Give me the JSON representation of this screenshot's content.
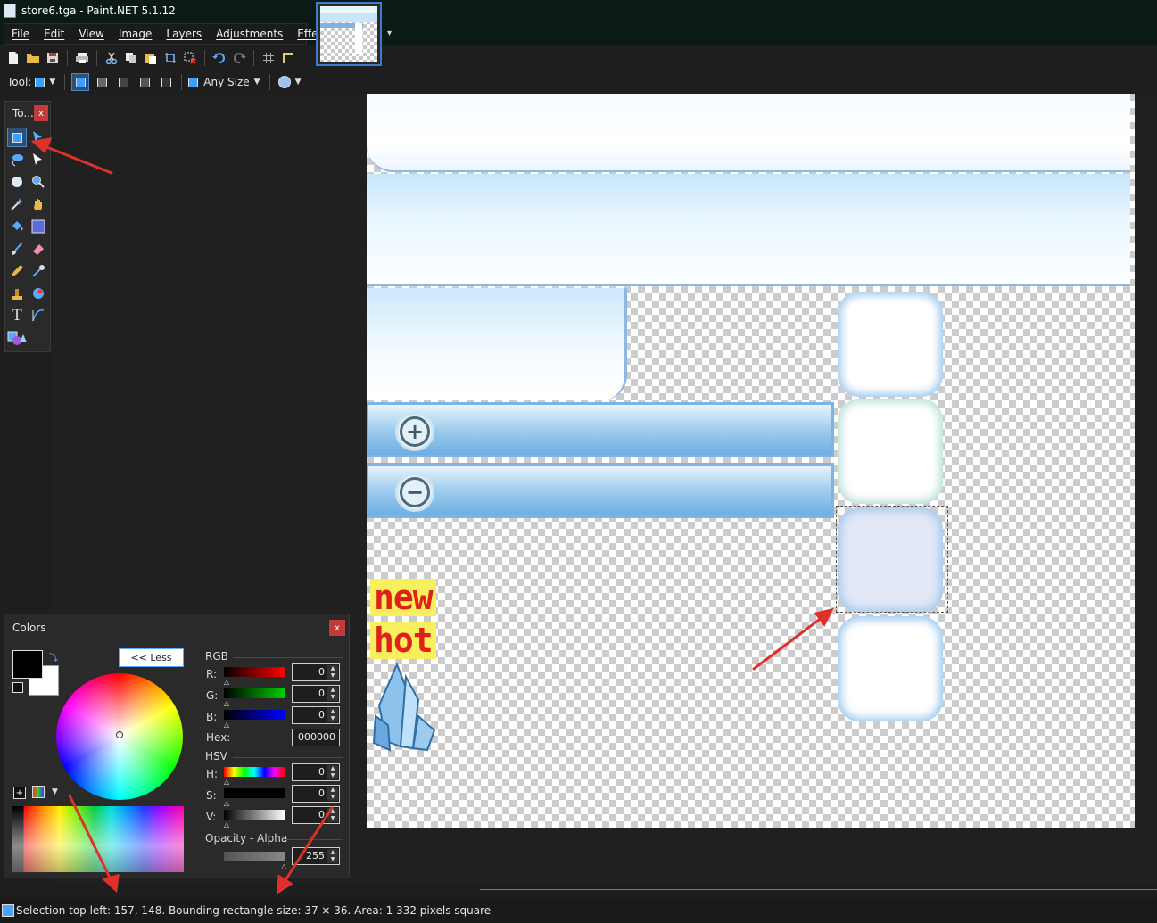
{
  "window": {
    "title": "store6.tga - Paint.NET 5.1.12"
  },
  "menu": {
    "items": [
      "File",
      "Edit",
      "View",
      "Image",
      "Layers",
      "Adjustments",
      "Effects"
    ]
  },
  "toolbar": {
    "icons": [
      "new-icon",
      "open-icon",
      "save-icon",
      "print-icon",
      "cut-icon",
      "copy-icon",
      "paste-icon",
      "crop-icon",
      "deselect-icon",
      "undo-icon",
      "redo-icon",
      "grid-icon",
      "ruler-icon"
    ],
    "tool_label": "Tool:",
    "size_label": "Any Size"
  },
  "tools_panel": {
    "title": "To...",
    "close": "x",
    "tools": [
      "rectangle-select",
      "move-selection",
      "lasso-select",
      "move-selected",
      "ellipse-select",
      "zoom",
      "magic-wand",
      "pan",
      "paint-bucket",
      "gradient",
      "paintbrush",
      "eraser",
      "pencil",
      "color-picker",
      "clone-stamp",
      "recolor",
      "text",
      "line-curve",
      "shapes"
    ]
  },
  "canvas": {
    "words": [
      "new",
      "hot"
    ],
    "plus_symbol": "+",
    "minus_symbol": "−"
  },
  "colors_panel": {
    "title": "Colors",
    "close": "x",
    "less_button": "<< Less",
    "rgb_label": "RGB",
    "r_label": "R:",
    "g_label": "G:",
    "b_label": "B:",
    "r": "0",
    "g": "0",
    "b": "0",
    "hex_label": "Hex:",
    "hex": "000000",
    "hsv_label": "HSV",
    "h_label": "H:",
    "s_label": "S:",
    "v_label": "V:",
    "h": "0",
    "s": "0",
    "v": "0",
    "opacity_label": "Opacity - Alpha",
    "alpha": "255",
    "primary_color": "#000000",
    "secondary_color": "#ffffff"
  },
  "status": {
    "text": "Selection top left: 157, 148. Bounding rectangle size: 37 × 36. Area: 1 332 pixels square"
  },
  "colors": {
    "accent": "#3c7bd0",
    "annotation_arrow": "#e0302a"
  }
}
